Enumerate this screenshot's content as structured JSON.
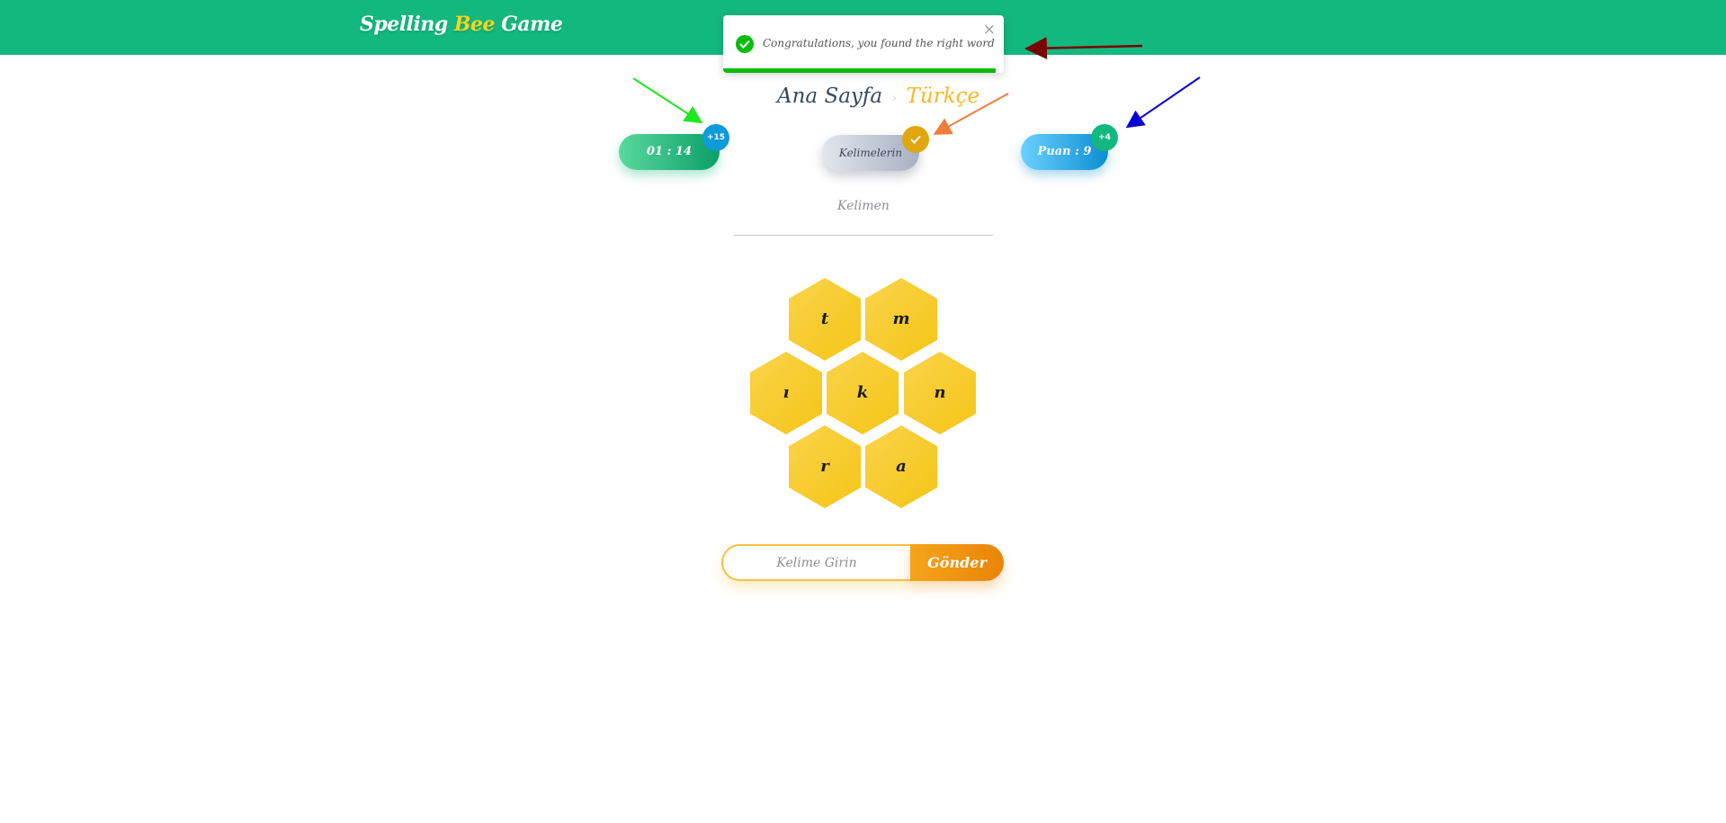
{
  "header": {
    "brand_part1": "Spelling ",
    "brand_part2": "Bee",
    "brand_part3": " Game"
  },
  "toast": {
    "message": "Congratulations, you found the right word",
    "close_glyph": "×",
    "icon": "check-circle-icon",
    "progress": 0.97
  },
  "breadcrumb": {
    "home": "Ana Sayfa",
    "separator": "›",
    "language": "Türkçe"
  },
  "timer": {
    "value": "01 : 14",
    "bonus": "+15"
  },
  "words_button": {
    "label": "Kelimelerin",
    "badge_icon": "check-icon"
  },
  "score": {
    "value": "Puan : 9",
    "bonus": "+4"
  },
  "current_word": {
    "text": "Kelimen"
  },
  "hive": {
    "letters": [
      "t",
      "m",
      "ı",
      "k",
      "n",
      "r",
      "a"
    ],
    "center_letter": "k"
  },
  "word_form": {
    "placeholder": "Kelime Girin",
    "value": "",
    "submit_label": "Gönder"
  },
  "colors": {
    "header_green": "#13b87e",
    "bee_yellow": "#f7d51d",
    "toast_green": "#07bc0c",
    "lang_orange": "#f5b922",
    "send_orange": "#e98408",
    "arrow_green": "#1ee81e",
    "arrow_orange": "#f07c3c",
    "arrow_blue": "#0a00d6",
    "arrow_darkred": "#7a0000"
  }
}
